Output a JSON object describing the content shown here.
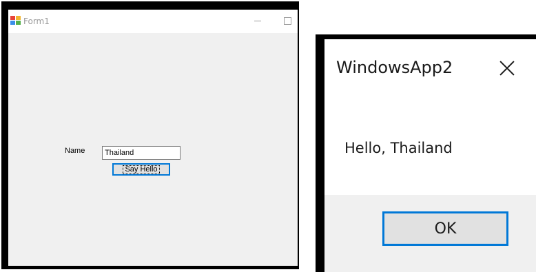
{
  "form1": {
    "title": "Form1",
    "icon": "windows-form-icon",
    "name_label": "Name",
    "name_value": "Thailand",
    "button_label": "Say Hello"
  },
  "messagebox": {
    "title": "WindowsApp2",
    "message": "Hello, Thailand",
    "ok_label": "OK",
    "close_icon": "close-icon"
  },
  "colors": {
    "focus_border": "#0078d7",
    "form_background": "#f0f0f0",
    "frame": "#000000"
  }
}
